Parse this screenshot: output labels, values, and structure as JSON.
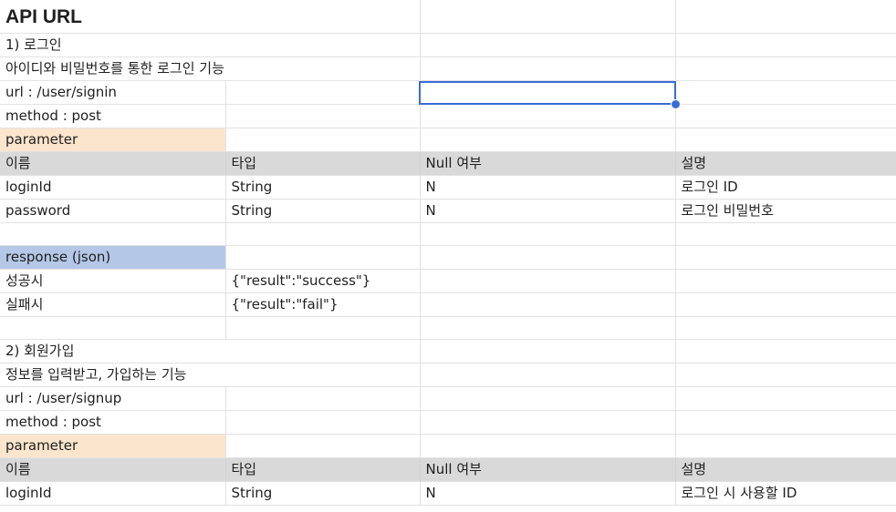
{
  "sheet": {
    "title": "API URL",
    "signin": {
      "heading": "1) 로그인",
      "description": "아이디와 비밀번호를 통한 로그인 기능",
      "url": "url : /user/signin",
      "method": "method : post",
      "parameter_label": "parameter",
      "header": [
        "이름",
        "타입",
        "Null 여부",
        "설명"
      ],
      "params": [
        [
          "loginId",
          "String",
          "N",
          "로그인 ID"
        ],
        [
          "password",
          "String",
          "N",
          "로그인 비밀번호"
        ]
      ],
      "response_label": "response (json)",
      "responses": [
        [
          "성공시",
          "{\"result\":\"success\"}"
        ],
        [
          "실패시",
          "{\"result\":\"fail\"}"
        ]
      ]
    },
    "signup": {
      "heading": "2) 회원가입",
      "description": "정보를 입력받고, 가입하는 기능",
      "url": "url : /user/signup",
      "method": "method : post",
      "parameter_label": "parameter",
      "header": [
        "이름",
        "타입",
        "Null 여부",
        "설명"
      ],
      "params": [
        [
          "loginId",
          "String",
          "N",
          "로그인 시 사용할 ID"
        ]
      ]
    }
  },
  "colors": {
    "parameter_bg": "#fce5cd",
    "response_bg": "#b4c7e7",
    "header_bg": "#d9d9d9",
    "selection": "#3b6bd6"
  }
}
